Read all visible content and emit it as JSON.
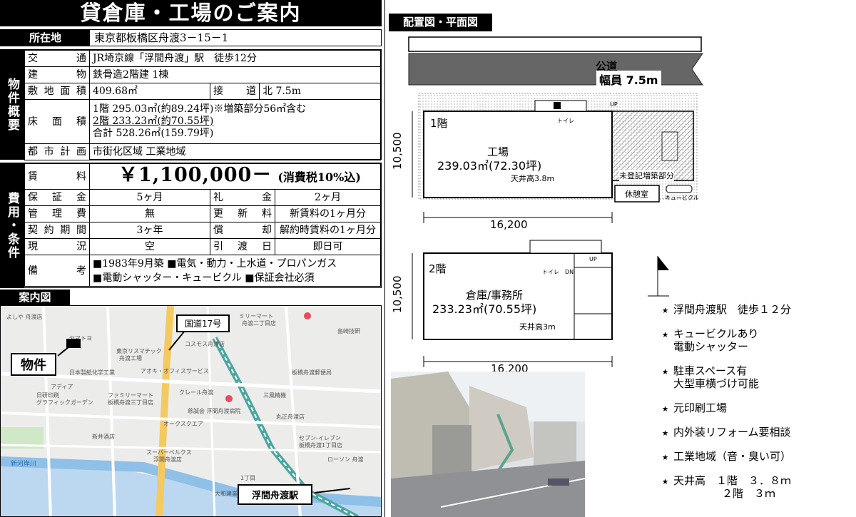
{
  "title": "貸倉庫・工場のご案内",
  "address": {
    "label": "所在地",
    "value": "東京都板橋区舟渡3－15－1"
  },
  "property": {
    "section_label": "物件概要",
    "access": {
      "label": "交通",
      "value": "JR埼京線「浮間舟渡」駅　徒歩12分"
    },
    "building": {
      "label": "建物",
      "value": "鉄骨造2階建 1棟"
    },
    "land_area": {
      "label": "敷地面積",
      "value": "409.68㎡"
    },
    "road": {
      "label": "接道",
      "value": "北 7.5m"
    },
    "floor_area": {
      "label": "床面積",
      "line1": "1階 295.03㎡(約89.24坪)※増築部分56㎡含む",
      "line2": "2階 233.23㎡(約70.55坪)",
      "line3": "合計 528.26㎡(159.79坪)"
    },
    "city_plan": {
      "label": "都市計画",
      "value": "市街化区域 工業地域"
    }
  },
  "terms": {
    "section_label": "費用・条件",
    "rent": {
      "label": "賃料",
      "price": "￥1,100,000－",
      "tax": "(消費税10%込)"
    },
    "deposit": {
      "label": "保証金",
      "value": "5ヶ月"
    },
    "key_money": {
      "label": "礼金",
      "value": "2ヶ月"
    },
    "mgmt_fee": {
      "label": "管理費",
      "value": "無"
    },
    "renewal_fee": {
      "label": "更新料",
      "value": "新賃料の1ヶ月分"
    },
    "term": {
      "label": "契約期間",
      "value": "3ヶ年"
    },
    "amortization": {
      "label": "償却",
      "value": "解約時賃料の1ヶ月分"
    },
    "status": {
      "label": "現況",
      "value": "空"
    },
    "handover": {
      "label": "引渡日",
      "value": "即日可"
    },
    "notes": {
      "label": "備考",
      "line1": "■1983年9月築 ■電気・動力・上水道・プロパンガス",
      "line2": "■電動シャッター・キュービクル ■保証会社必須"
    }
  },
  "map": {
    "title": "案内図",
    "property_label": "物件",
    "route_label": "国道17号",
    "station_label": "浮間舟渡駅",
    "places": [
      "ミリーマート",
      "舟渡二丁目店",
      "東京リスマチック",
      "舟渡工場",
      "コスモス舟渡店",
      "日本製紙化学工業",
      "アオキ・オフィスサービス",
      "板橋舟渡郵便局",
      "日研印刷",
      "グラフィックガーデン",
      "ファミリーマート",
      "板橋舟渡三丁目店",
      "クレール舟渡",
      "慈誠会 浮間舟渡病院",
      "丸正舟渡店",
      "新井酒店",
      "スーパーベルクス",
      "浮間舟渡店",
      "セブン-イレブン",
      "板橋舟渡1丁目店",
      "ローソン 舟渡",
      "新河岸川",
      "アディア",
      "よしや 舟渡店",
      "三風精機",
      "島崎技研",
      "オークスクエア",
      "ヤマトヨ",
      "大和建業",
      "1丁目"
    ]
  },
  "plan": {
    "title": "配置図・平面図",
    "road_label": "公道",
    "road_width": "幅員 7.5m",
    "floor1": {
      "label": "1階",
      "use": "工場",
      "area": "239.03㎡(72.30坪)",
      "ceiling": "天井高3.8m",
      "width": "16,200",
      "depth": "10,500",
      "annex": "未登記増築部分",
      "rest": "休憩室",
      "cubicle": "キュービクル",
      "toilet": "トイレ",
      "up": "UP"
    },
    "floor2": {
      "label": "2階",
      "use": "倉庫/事務所",
      "area": "233.23㎡(70.55坪)",
      "ceiling": "天井高3m",
      "width": "16,200",
      "depth": "10,500",
      "toilet": "トイレ",
      "dn": "DN",
      "up": "UP"
    }
  },
  "features": [
    {
      "line1": "浮間舟渡駅　徒歩１２分"
    },
    {
      "line1": "キュービクルあり",
      "line2": "電動シャッター"
    },
    {
      "line1": "駐車スペース有",
      "line2": "大型車横づけ可能"
    },
    {
      "line1": "元印刷工場"
    },
    {
      "line1": "内外装リフォーム要相談"
    },
    {
      "line1": "工業地域（音・臭い可）"
    },
    {
      "line1": "天井高　１階　３．８ｍ",
      "line2": "２階　３ｍ"
    }
  ],
  "feature_star": "★"
}
